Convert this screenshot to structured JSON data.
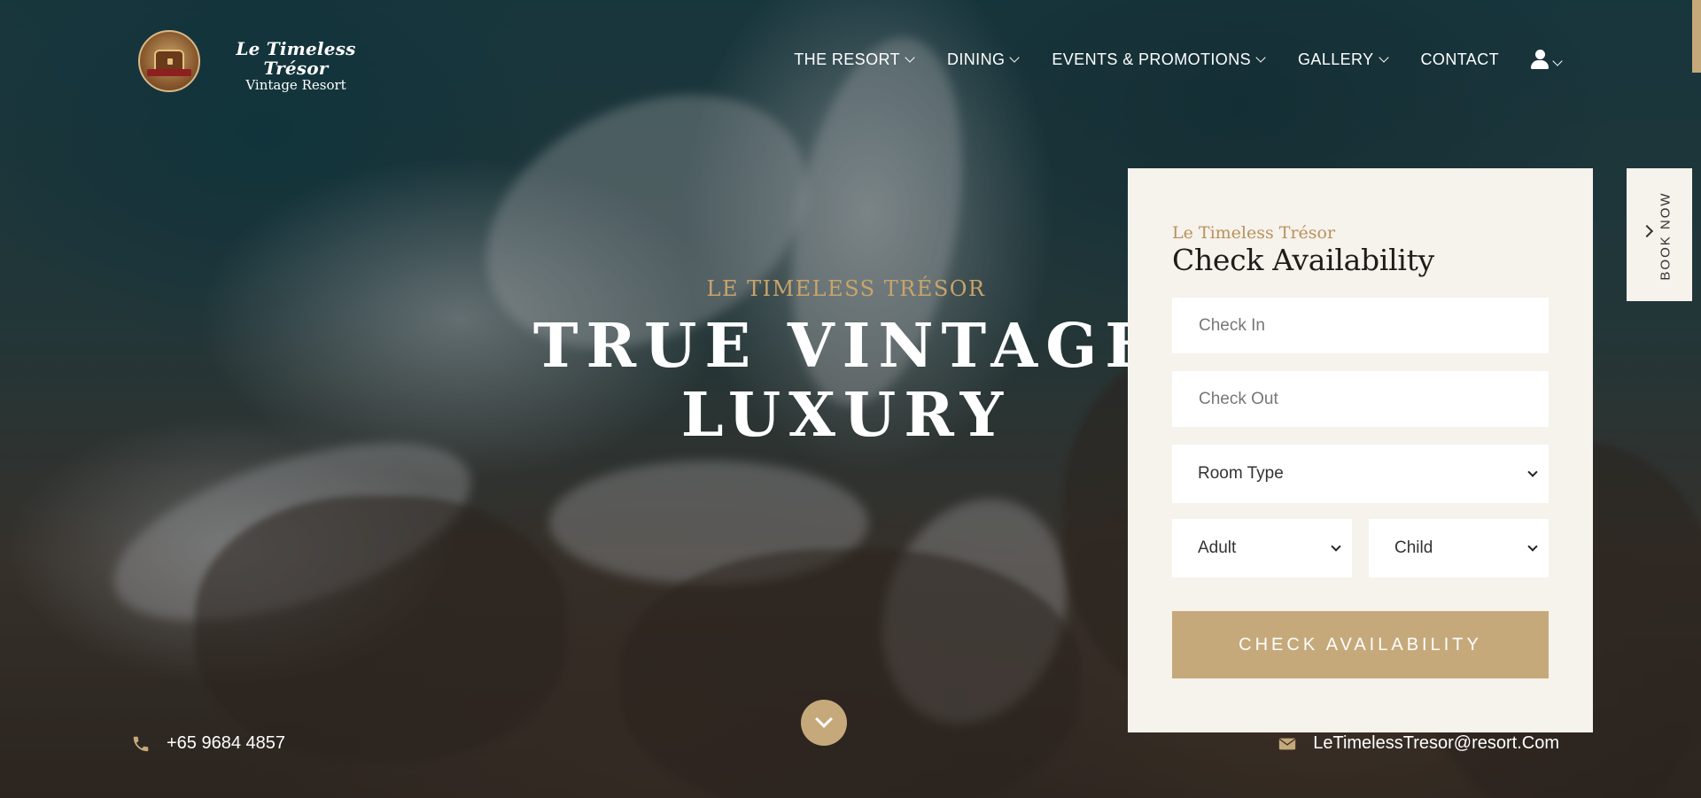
{
  "brand": {
    "title": "Le Timeless Trésor",
    "subtitle": "Vintage Resort"
  },
  "nav": {
    "items": [
      {
        "label": "THE RESORT",
        "has_dropdown": true
      },
      {
        "label": "DINING",
        "has_dropdown": true
      },
      {
        "label": "EVENTS & PROMOTIONS",
        "has_dropdown": true
      },
      {
        "label": "GALLERY",
        "has_dropdown": true
      },
      {
        "label": "CONTACT",
        "has_dropdown": false
      }
    ],
    "user_icon": "user-icon"
  },
  "hero": {
    "kicker": "LE TIMELESS TRÉSOR",
    "title": "TRUE VINTAGE LUXURY"
  },
  "booking": {
    "kicker": "Le Timeless Trésor",
    "title": "Check Availability",
    "check_in_placeholder": "Check In",
    "check_out_placeholder": "Check Out",
    "room_type": "Room Type",
    "adult": "Adult",
    "child": "Child",
    "submit_label": "CHECK AVAILABILITY"
  },
  "book_now": {
    "label": "BOOK NOW"
  },
  "contact": {
    "phone": "+65 9684 4857",
    "email": "LeTimelessTresor@resort.Com"
  },
  "colors": {
    "accent": "#c6a97a",
    "kicker": "#c9a46a",
    "panel_bg": "#f6f2ec"
  }
}
